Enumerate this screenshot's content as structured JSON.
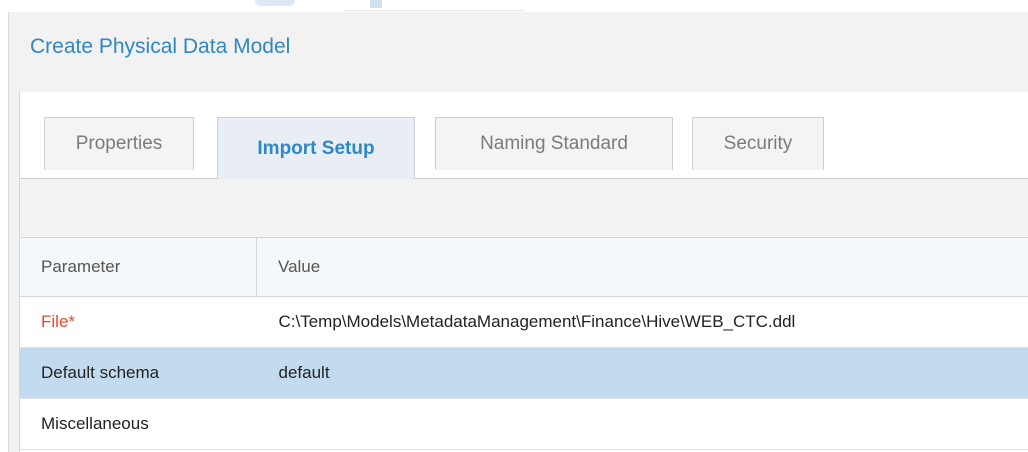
{
  "dialog": {
    "title": "Create Physical Data Model"
  },
  "tabs": [
    {
      "label": "Properties",
      "active": false
    },
    {
      "label": "Import Setup",
      "active": true
    },
    {
      "label": "Naming Standard",
      "active": false
    },
    {
      "label": "Security",
      "active": false
    }
  ],
  "grid": {
    "columns": [
      "Parameter",
      "Value"
    ],
    "rows": [
      {
        "parameter": "File*",
        "value": "C:\\Temp\\Models\\MetadataManagement\\Finance\\Hive\\WEB_CTC.ddl",
        "required": true
      },
      {
        "parameter": "Default schema",
        "value": "default",
        "selected": true
      },
      {
        "parameter": "Miscellaneous",
        "value": ""
      }
    ]
  },
  "colors": {
    "accent": "#2f87c6",
    "required": "#e8492a",
    "selected_row": "#c3dbee"
  }
}
